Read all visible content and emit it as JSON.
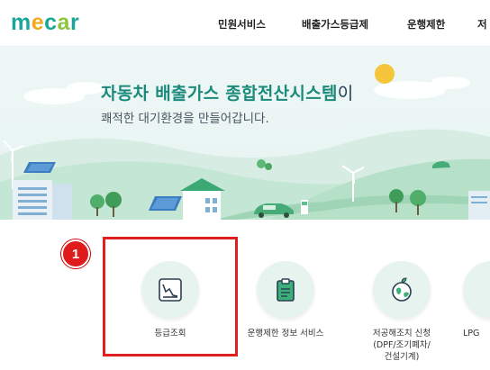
{
  "header": {
    "logo_text": "mecar",
    "nav": [
      "민원서비스",
      "배출가스등급제",
      "운행제한",
      "저"
    ]
  },
  "hero": {
    "title_main": "자동차 배출가스 종합전산시스템",
    "title_suffix": "이",
    "subtitle": "쾌적한 대기환경을 만들어갑니다."
  },
  "services": [
    {
      "label": "등급조회",
      "sub": [
        "",
        ""
      ],
      "icon": "graph-icon"
    },
    {
      "label": "운행제한 정보 서비스",
      "sub": [
        "",
        ""
      ],
      "icon": "clipboard-icon"
    },
    {
      "label": "저공해조치 신청",
      "sub": [
        "(DPF/조기폐차/",
        "건설기계)"
      ],
      "icon": "globe-leaf-icon"
    },
    {
      "label": "LPG",
      "sub": [
        "",
        ""
      ],
      "icon": "partial-icon"
    }
  ],
  "annotation": {
    "marker": "1"
  }
}
